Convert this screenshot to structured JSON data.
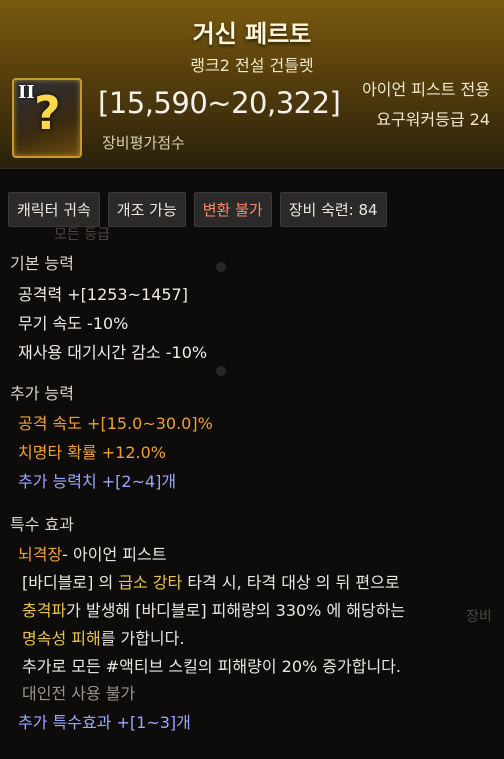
{
  "header": {
    "item_name": "거신 페르토",
    "item_rarity_type": "랭크2 전설 건틀렛",
    "icon_rank": "II",
    "damage_range": "[15,590~20,322]",
    "score_label": "장비평가점수",
    "weapon_type": "아이언 피스트 전용",
    "required_level": "요구워커등급 24"
  },
  "badges": [
    {
      "label": "캐릭터 귀속"
    },
    {
      "label": "개조 가능"
    },
    {
      "label": "변환 불가"
    },
    {
      "label": "장비 숙련: 84"
    }
  ],
  "basic": {
    "title": "기본 능력",
    "stats": [
      "공격력  +[1253~1457]",
      "무기 속도 -10%",
      "재사용 대기시간 감소 -10%"
    ]
  },
  "additional": {
    "title": "추가 능력",
    "stats": [
      "공격 속도  +[15.0~30.0]%",
      "치명타 확률  +12.0%",
      "추가 능력치 +[2~4]개"
    ]
  },
  "special": {
    "title": "특수 효과",
    "line1_name": "뇌격장",
    "line1_rest": "- 아이언 피스트",
    "line2_a": "[바디블로] 의 ",
    "line2_b": "급소 강타",
    "line2_c": " 타격 시, 타격 대상 의 뒤 편으로",
    "line3_a": "충격파",
    "line3_b": "가 발생해 [바디블로] 피해량의 330% 에 해당하는",
    "line4_a": "명속성 피해",
    "line4_b": "를 가합니다.",
    "line5": "추가로 모든 #액티브 스킬의 피해량이 20% 증가합니다.",
    "line6": "대인전 사용 불가",
    "line7": "추가 특수효과 +[1~3]개"
  },
  "background": {
    "bleed1": "모든 등급",
    "bleed2": "장비"
  }
}
